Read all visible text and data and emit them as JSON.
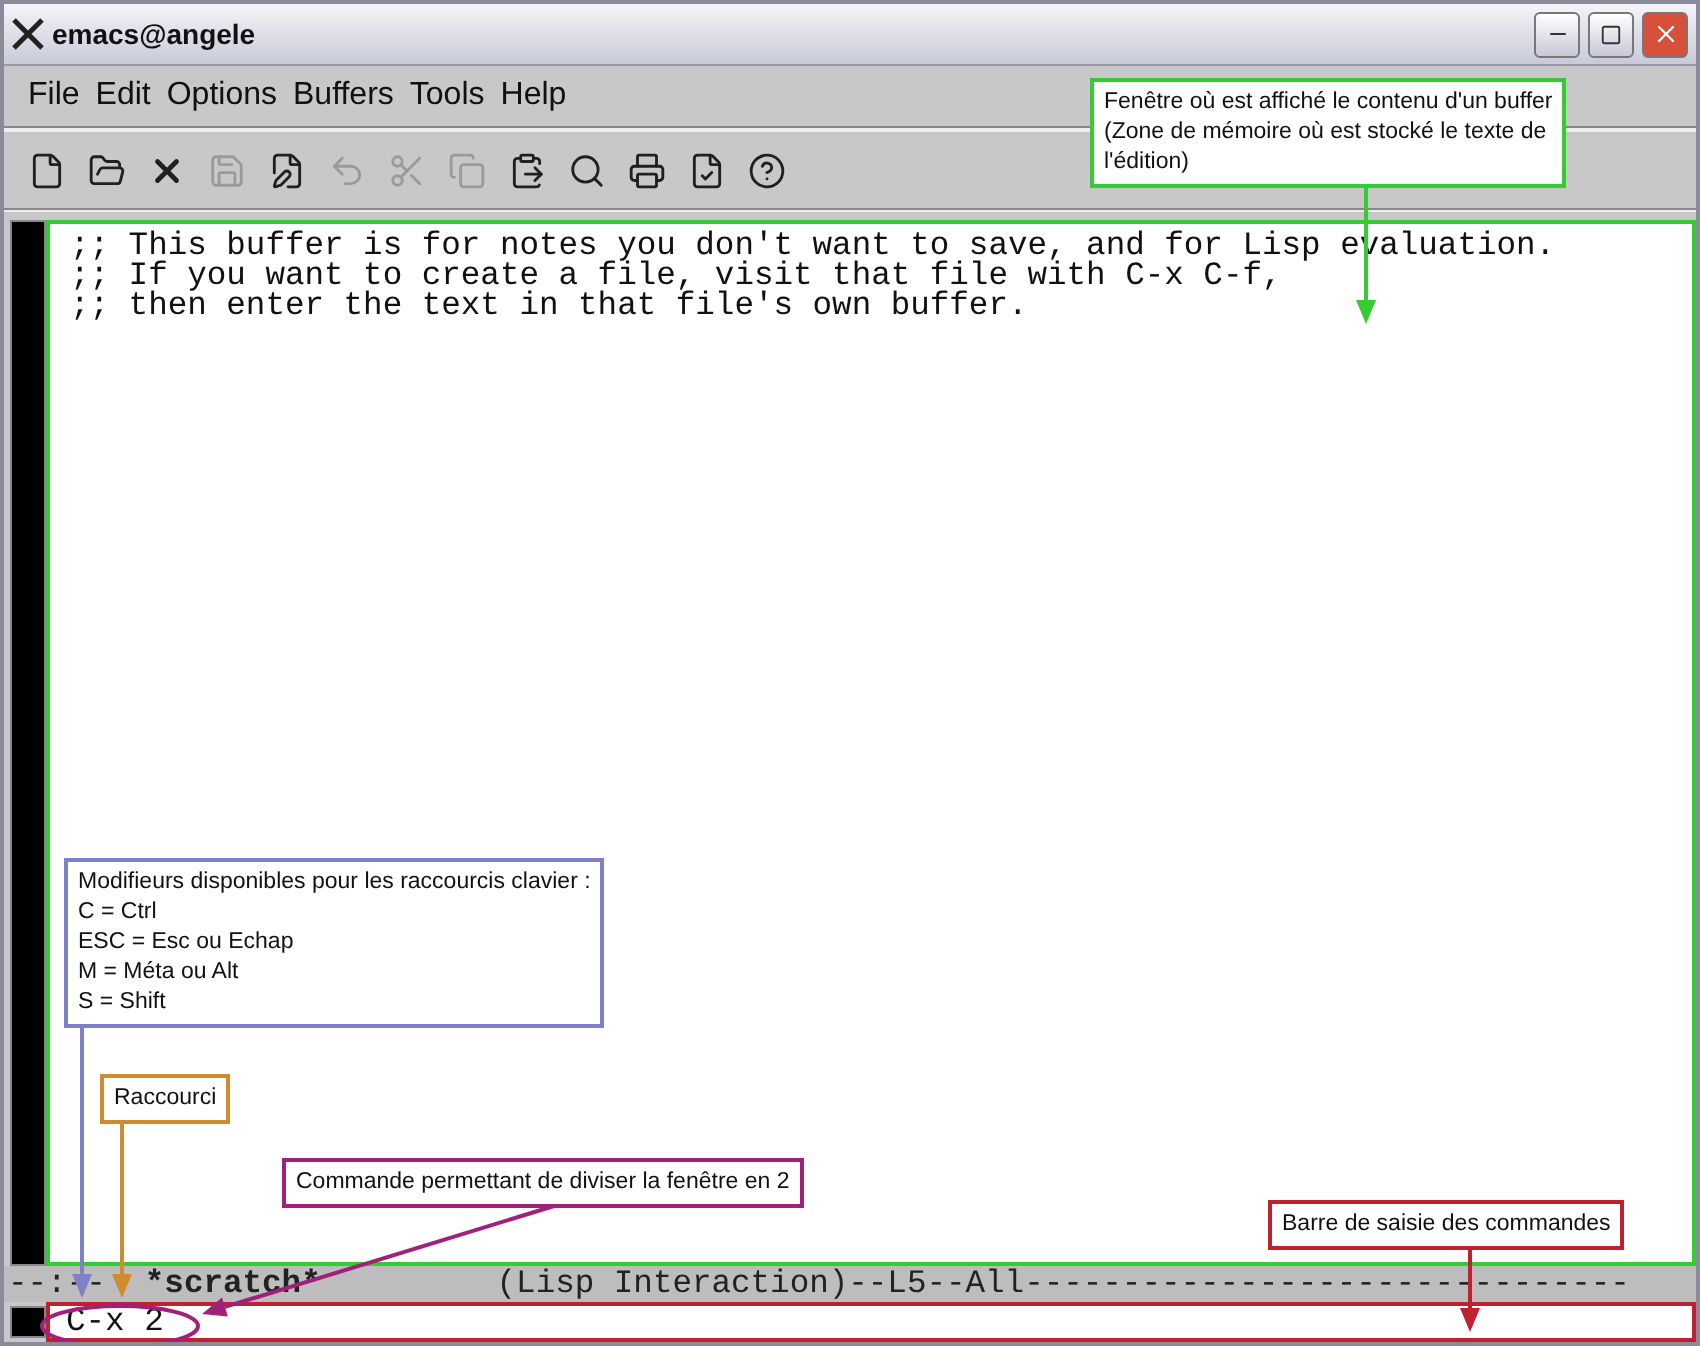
{
  "window": {
    "title": "emacs@angele"
  },
  "menu": [
    "File",
    "Edit",
    "Options",
    "Buffers",
    "Tools",
    "Help"
  ],
  "toolbar": [
    {
      "disabled": false
    },
    {
      "disabled": false
    },
    {
      "disabled": false
    },
    {
      "disabled": true
    },
    {
      "disabled": false
    },
    {
      "disabled": true
    },
    {
      "disabled": true
    },
    {
      "disabled": true
    },
    {
      "disabled": false
    },
    {
      "disabled": false
    },
    {
      "disabled": false
    },
    {
      "disabled": false
    },
    {
      "disabled": false
    }
  ],
  "buffer": {
    "lines": [
      ";; This buffer is for notes you don't want to save, and for Lisp evaluation.",
      ";; If you want to create a file, visit that file with C-x C-f,",
      ";; then enter the text in that file's own buffer."
    ]
  },
  "mode_line": {
    "status": "--:--",
    "buffer_name": "*scratch*",
    "rest": "(Lisp Interaction)--L5--All-------------------------------"
  },
  "minibuffer": {
    "value": "C-x 2"
  },
  "callouts": [
    {
      "lines": [
        "Fenêtre où est affiché le contenu d'un buffer",
        "(Zone de mémoire où est stocké le texte de",
        "l'édition)"
      ],
      "color": "#33cc33"
    },
    {
      "lines": [
        "Modifieurs disponibles pour les raccourcis clavier :",
        "C = Ctrl",
        "ESC = Esc ou Echap",
        "M = Méta ou Alt",
        "S = Shift"
      ],
      "color": "#8080c8"
    },
    {
      "lines": [
        "Raccourci"
      ],
      "color": "#d08a30"
    },
    {
      "lines": [
        "Commande permettant de diviser la fenêtre en 2"
      ],
      "color": "#a0207a"
    },
    {
      "lines": [
        "Barre de saisie des commandes"
      ],
      "color": "#c02030"
    }
  ]
}
